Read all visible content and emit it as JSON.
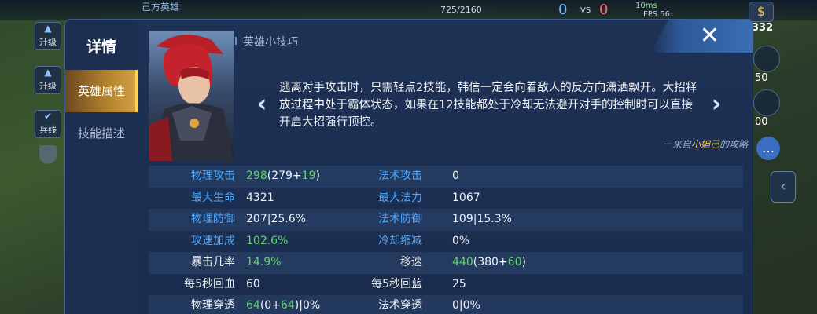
{
  "hud": {
    "team_label": "己方英雄",
    "score": "725/2160",
    "kills_ally": "0",
    "vs": "VS",
    "kills_enemy": "0",
    "network": "10ms",
    "fps": "FPS 56",
    "gold": "332",
    "upgrade_label": "升级",
    "soldier_line": "兵线",
    "side_values": [
      "50",
      "00"
    ]
  },
  "modal": {
    "title": "详情",
    "tabs": [
      {
        "label": "英雄属性",
        "active": true
      },
      {
        "label": "技能描述",
        "active": false
      }
    ],
    "tips": {
      "header": "英雄小技巧",
      "text": "逃离对手攻击时，只需轻点2技能，韩信一定会向着敌人的反方向潇洒飘开。大招释放过程中处于霸体状态，如果在12技能都处于冷却无法避开对手的控制时可以直接开启大招强行顶控。",
      "credit_prefix": "一来自",
      "credit_author": "小妲己",
      "credit_suffix": "的攻略"
    },
    "stats": [
      {
        "left": {
          "label": "物理攻击",
          "label_color": "blue",
          "base": "",
          "green_main": "298",
          "rest": "(279+",
          "green_bonus": "19",
          "tail": ")"
        },
        "right": {
          "label": "法术攻击",
          "label_color": "blue",
          "value": "0"
        }
      },
      {
        "left": {
          "label": "最大生命",
          "label_color": "blue",
          "value": "4321"
        },
        "right": {
          "label": "最大法力",
          "label_color": "blue",
          "value": "1067"
        }
      },
      {
        "left": {
          "label": "物理防御",
          "label_color": "blue",
          "value": "207|25.6%"
        },
        "right": {
          "label": "法术防御",
          "label_color": "blue",
          "value": "109|15.3%"
        }
      },
      {
        "left": {
          "label": "攻速加成",
          "label_color": "blue",
          "green_value": "102.6%"
        },
        "right": {
          "label": "冷却缩减",
          "label_color": "blue",
          "value": "0%"
        }
      },
      {
        "left": {
          "label": "暴击几率",
          "label_color": "white",
          "green_value": "14.9%"
        },
        "right": {
          "label": "移速",
          "label_color": "white",
          "green_main": "440",
          "rest": "(380+",
          "green_bonus": "60",
          "tail": ")"
        }
      },
      {
        "left": {
          "label": "每5秒回血",
          "label_color": "white",
          "value": "60"
        },
        "right": {
          "label": "每5秒回蓝",
          "label_color": "white",
          "value": "25"
        }
      },
      {
        "left": {
          "label": "物理穿透",
          "label_color": "white",
          "green_main": "64",
          "rest": "(0+",
          "green_bonus": "64",
          "tail": ")|0%"
        },
        "right": {
          "label": "法术穿透",
          "label_color": "white",
          "value": "0|0%"
        }
      }
    ]
  },
  "colors": {
    "accent_gold": "#d4a244",
    "stat_label_blue": "#4ea9ff",
    "stat_green": "#5fd36a",
    "panel_bg": "#1a2a48"
  }
}
